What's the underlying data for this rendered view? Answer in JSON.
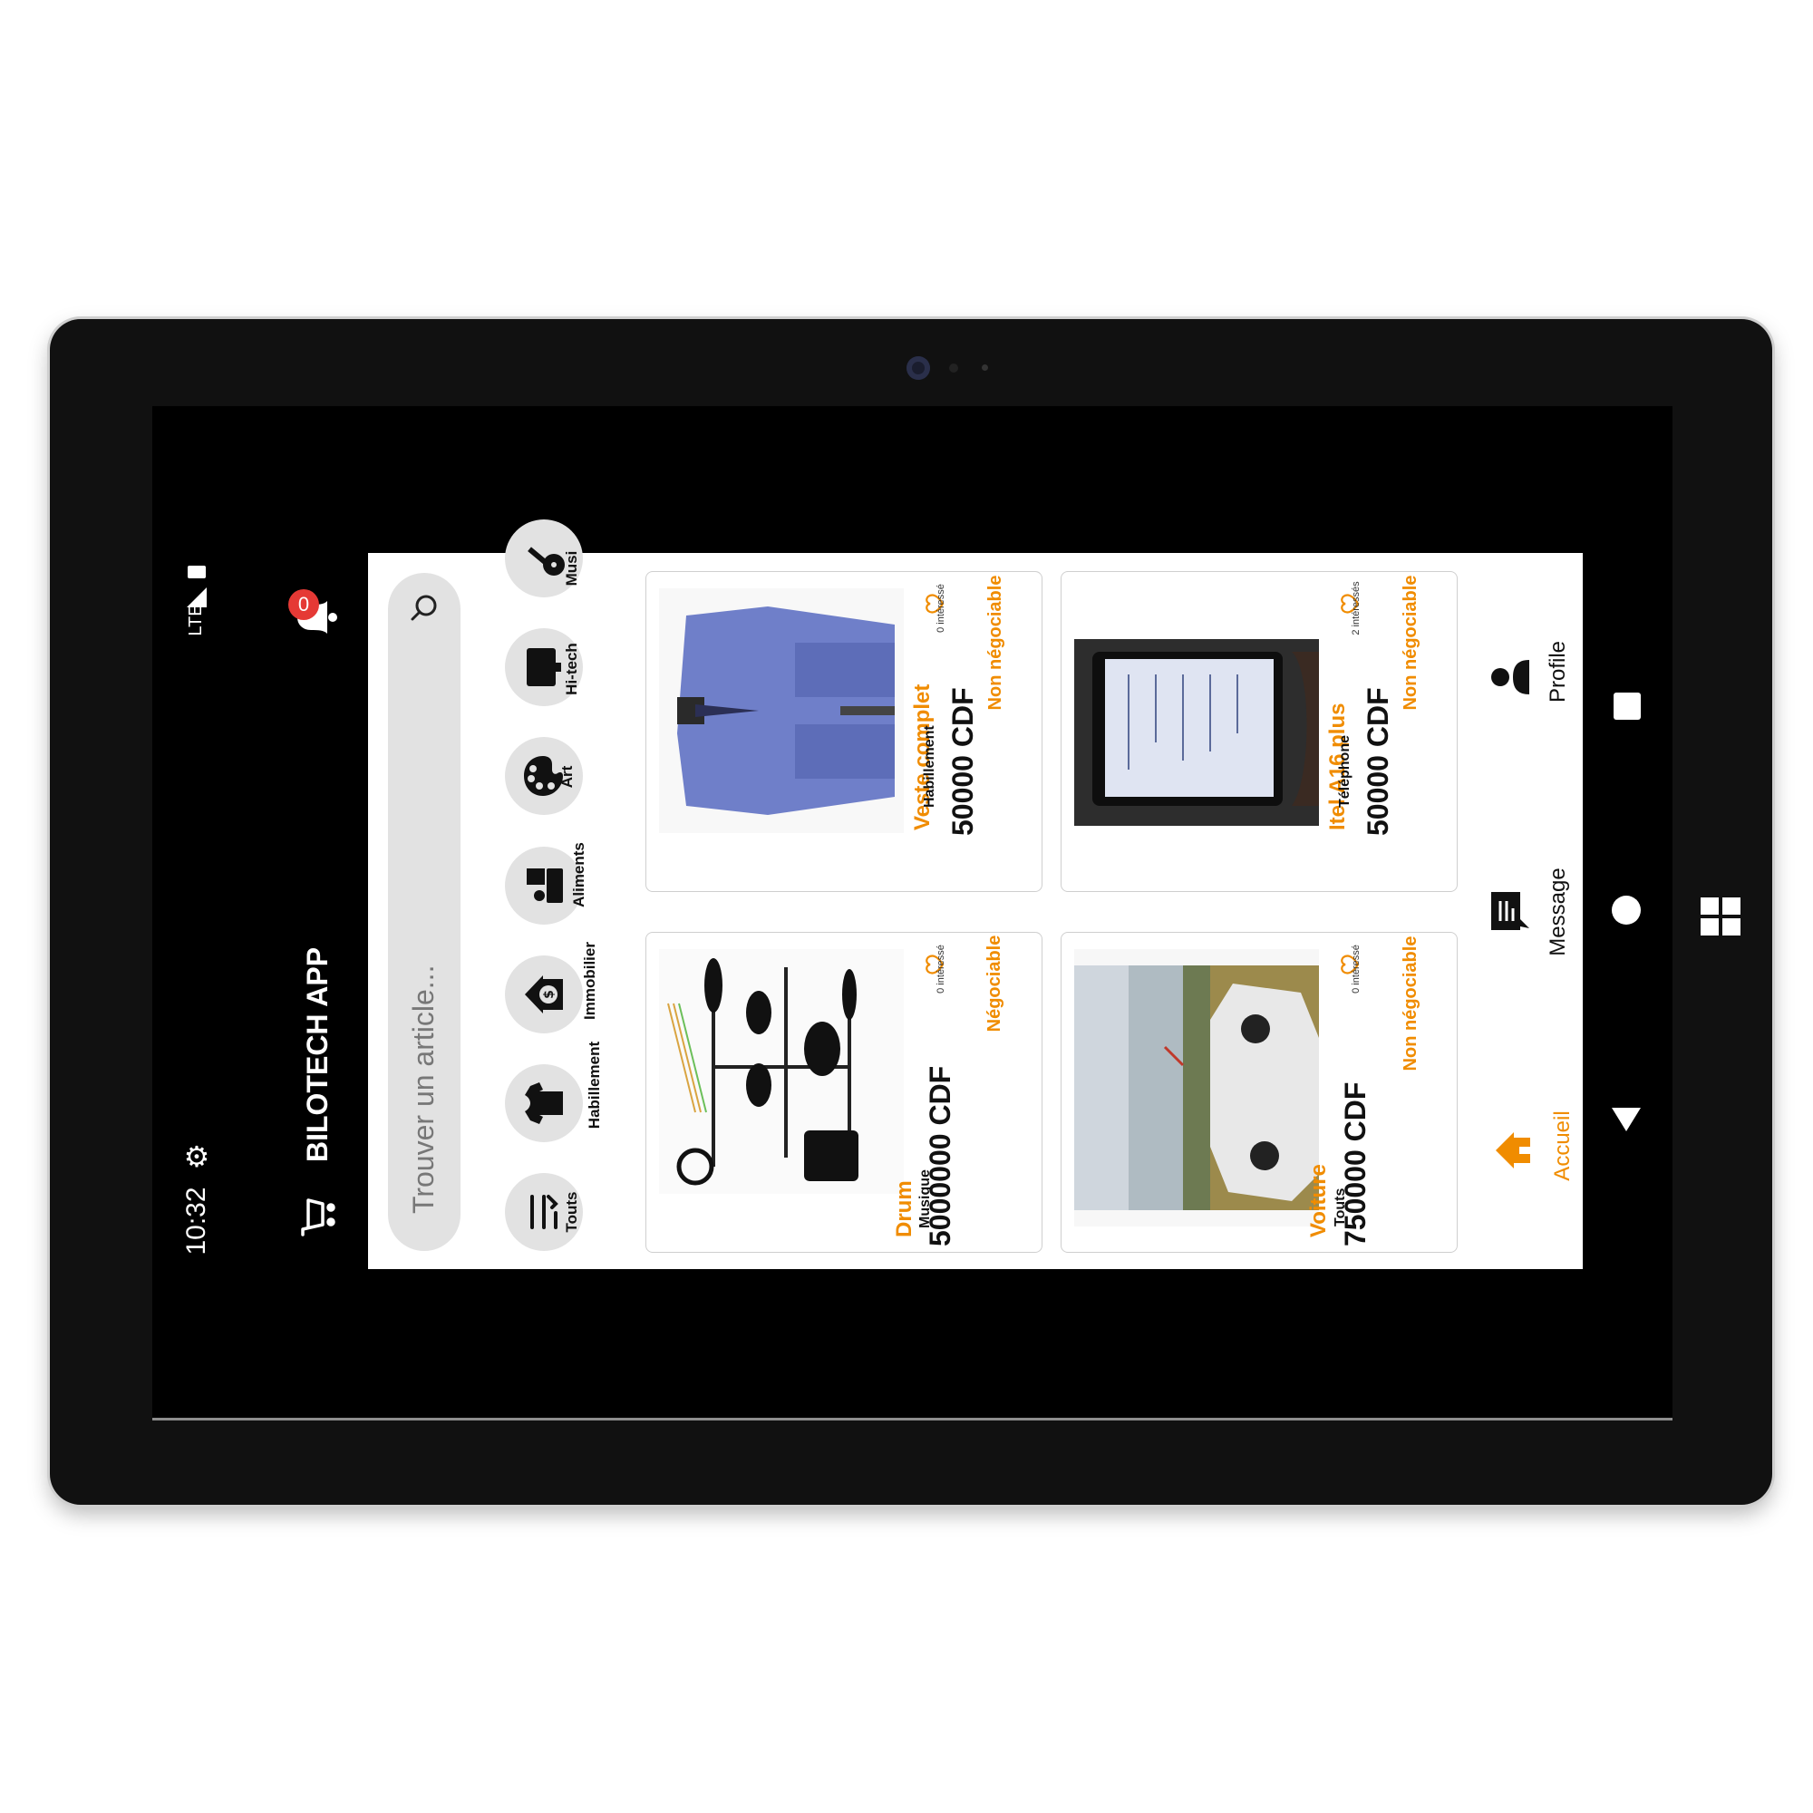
{
  "status_bar": {
    "time": "10:32",
    "network": "LTE"
  },
  "header": {
    "title": "BILOTECH APP",
    "notification_count": "0"
  },
  "search": {
    "placeholder": "Trouver un article..."
  },
  "categories": [
    {
      "label": "Touts",
      "icon": "list-icon"
    },
    {
      "label": "Habillement",
      "icon": "shirt-icon"
    },
    {
      "label": "Immobilier",
      "icon": "house-dollar-icon"
    },
    {
      "label": "Aliments",
      "icon": "food-icon"
    },
    {
      "label": "Art",
      "icon": "palette-icon"
    },
    {
      "label": "Hi-tech",
      "icon": "device-icon"
    },
    {
      "label": "Musi",
      "icon": "guitar-icon"
    }
  ],
  "products": [
    {
      "name": "Veste complet",
      "category": "Habillement",
      "price": "50000 CDF",
      "negotiation": "Non négociable",
      "interest": "0 intéressé",
      "image": "suit-photo"
    },
    {
      "name": "Itel A16 plus",
      "category": "Téléphone",
      "price": "50000 CDF",
      "negotiation": "Non négociable",
      "interest": "2 intéressés",
      "image": "phone-photo"
    },
    {
      "name": "Drum",
      "category": "Musique",
      "price": "5000000 CDF",
      "negotiation": "Négociable",
      "interest": "0 intéressé",
      "image": "drum-kit-photo"
    },
    {
      "name": "Voiture",
      "category": "Touts",
      "price": "750000 CDF",
      "negotiation": "Non négociable",
      "interest": "0 intéressé",
      "image": "car-photo"
    }
  ],
  "nav": [
    {
      "label": "Accueil",
      "icon": "home-icon",
      "active": true
    },
    {
      "label": "Message",
      "icon": "message-icon",
      "active": false
    },
    {
      "label": "Profile",
      "icon": "profile-icon",
      "active": false
    }
  ],
  "colors": {
    "accent": "#f08c00",
    "badge": "#e53935",
    "frame": "#111111",
    "chip": "#e2e2e2"
  }
}
